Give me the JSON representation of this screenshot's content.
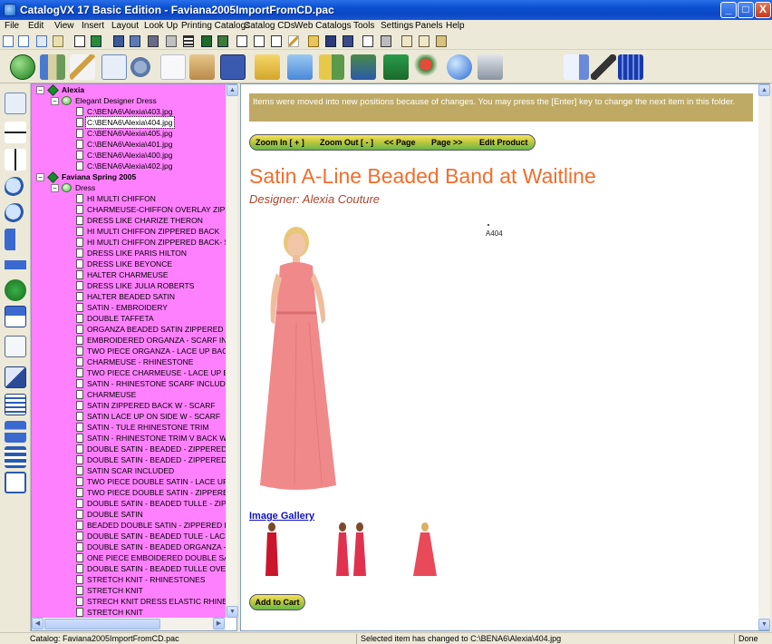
{
  "window": {
    "title": "CatalogVX 17 Basic Edition - Faviana2005ImportFromCD.pac",
    "controls": {
      "minimize": "_",
      "maximize": "□",
      "close": "X"
    }
  },
  "menu": [
    "File",
    "Edit",
    "View",
    "Insert",
    "Layout",
    "Look Up",
    "Printing Catalogs",
    "Catalog CDs",
    "Web Catalogs",
    "Tools",
    "Settings",
    "Panels",
    "Help"
  ],
  "toolbar_small_icons": [
    "new-document",
    "new-page",
    "pages",
    "wand",
    "copy",
    "paste",
    "lock",
    "add-page",
    "add-item",
    "grid",
    "grid-dark",
    "photo",
    "page",
    "page-blank",
    "page-blank",
    "page-blank",
    "pencil",
    "open-folder",
    "save",
    "save-as",
    "copy-doc",
    "print",
    "tag",
    "tag-alt",
    "images"
  ],
  "toolbar_big_icons": [
    "home",
    "books",
    "wand",
    "documents",
    "settings",
    "blank-page",
    "stack",
    "save",
    "folder-open",
    "folder",
    "book-add",
    "books-stack",
    "book-arrow",
    "pin-arrow",
    "globe",
    "printer",
    "script",
    "eraser",
    "grid-panel"
  ],
  "left_tool_icons": [
    "document-arrange",
    "move-up",
    "move-top",
    "zoom-in",
    "zoom-out",
    "sort",
    "shuffle",
    "link",
    "home",
    "print-preview",
    "edit",
    "edit-list",
    "network",
    "hierarchy",
    "layout"
  ],
  "tree": {
    "catalog_1": "Alexia",
    "folder_1": "Elegant Designer Dress",
    "files": [
      "C:\\BENA6\\Alexia\\403.jpg",
      "C:\\BENA6\\Alexia\\404.jpg",
      "C:\\BENA6\\Alexia\\405.jpg",
      "C:\\BENA6\\Alexia\\401.jpg",
      "C:\\BENA6\\Alexia\\400.jpg",
      "C:\\BENA6\\Alexia\\402.jpg"
    ],
    "catalog_2": "Faviana Spring 2005",
    "folder_2": "Dress",
    "items": [
      "HI MULTI CHIFFON",
      "CHARMEUSE-CHIFFON OVERLAY ZIPPERE",
      "DRESS LIKE CHARIZE THERON",
      "HI MULTI CHIFFON ZIPPERED BACK",
      "HI MULTI CHIFFON ZIPPERED BACK- SCAR",
      "DRESS LIKE PARIS HILTON",
      "DRESS LIKE BEYONCE",
      "HALTER CHARMEUSE",
      "DRESS LIKE JULIA ROBERTS",
      "HALTER BEADED SATIN",
      "SATIN - EMBROIDERY",
      "DOUBLE TAFFETA",
      "ORGANZA BEADED SATIN ZIPPERED BACK",
      "EMBROIDERED ORGANZA - SCARF INCLU",
      "TWO PIECE ORGANZA - LACE UP BACK",
      "CHARMEUSE - RHINESTONE",
      "TWO PIECE CHARMEUSE - LACE UP BACK",
      "SATIN - RHINESTONE SCARF INCLUDED",
      "CHARMEUSE",
      "SATIN ZIPPERED BACK W - SCARF",
      "SATIN LACE UP ON SIDE W - SCARF",
      "SATIN - TULE RHINESTONE TRIM",
      "SATIN - RHINESTONE TRIM V BACK W - ZI",
      "DOUBLE SATIN - BEADED - ZIPPERED BAC",
      "DOUBLE SATIN - BEADED - ZIPPERED BAC",
      "SATIN SCAR INCLUDED",
      "TWO PIECE DOUBLE SATIN - LACE UP BAC",
      "TWO PIECE DOUBLE SATIN - ZIPPERED BA",
      "DOUBLE SATIN - BEADED TULLE - ZIPPERE",
      "DOUBLE SATIN",
      "BEADED DOUBLE SATIN - ZIPPERED BACK",
      "DOUBLE SATIN - BEADED TULE - LACE UP",
      "DOUBLE SATIN - BEADED ORGANZA - ZIP",
      "ONE PIECE EMBOIDERED DOUBLE SATIN",
      "DOUBLE SATIN - BEADED TULLE OVERLAY",
      "STRETCH KNIT - RHINESTONES",
      "STRETCH KNIT",
      "STRECH KNIT DRESS ELASTIC RHINESTON",
      "STRETCH KNIT"
    ],
    "selected_file": "C:\\BENA6\\Alexia\\404.jpg"
  },
  "content": {
    "message": "Items were moved into new positions because of changes. You may press the [Enter] key to change the next item in this folder.",
    "nav": [
      "Zoom In [ + ]",
      "Zoom Out [ - ]",
      "<< Page",
      "Page >>",
      "Edit Product"
    ],
    "product_title": "Satin A-Line Beaded Band at Waitline",
    "designer": "Designer: Alexia Couture",
    "code": "A404",
    "gallery_label": "Image Gallery",
    "add_to_cart": "Add to Cart"
  },
  "colors": {
    "tree_bg": "#ff80ff",
    "title_orange": "#f26d2b",
    "message_bg": "#bfaa65",
    "dress_pink": "#f0898a"
  },
  "status": {
    "catalog": "Catalog: Faviana2005ImportFromCD.pac",
    "message": "Selected item has changed to C:\\BENA6\\Alexia\\404.jpg",
    "state": "Done"
  }
}
